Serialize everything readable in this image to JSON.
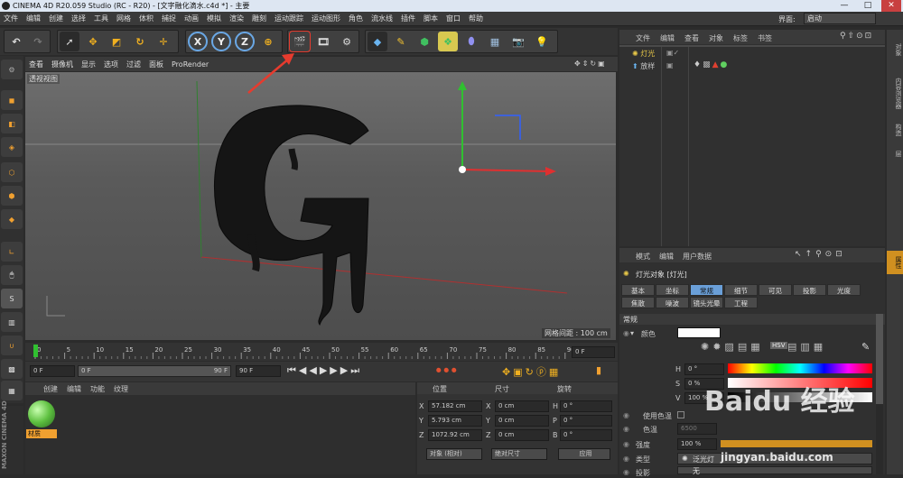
{
  "titlebar": {
    "title": "CINEMA 4D R20.059 Studio (RC - R20) - [文字融化滴水.c4d *] - 主要",
    "minimize": "—",
    "maximize": "□",
    "close": "✕"
  },
  "menubar": [
    "文件",
    "编辑",
    "创建",
    "选择",
    "工具",
    "网格",
    "体积",
    "捕捉",
    "动画",
    "模拟",
    "渲染",
    "雕刻",
    "运动跟踪",
    "运动图形",
    "角色",
    "流水线",
    "插件",
    "脚本",
    "窗口",
    "帮助"
  ],
  "layout": {
    "label": "界面:",
    "value": "启动"
  },
  "viewport": {
    "menu": [
      "查看",
      "摄像机",
      "显示",
      "选项",
      "过滤",
      "面板",
      "ProRender"
    ],
    "label": "透视视图",
    "grid_info": "网格间距 : 100 cm",
    "object_text": "G"
  },
  "timeline": {
    "ticks": [
      "0",
      "5",
      "10",
      "15",
      "20",
      "25",
      "30",
      "35",
      "40",
      "45",
      "50",
      "55",
      "60",
      "65",
      "70",
      "75",
      "80",
      "85",
      "90"
    ],
    "end_frame": "0 F"
  },
  "transport": {
    "start": "0 F",
    "current": "0 F",
    "range_end": "90 F",
    "end": "90 F"
  },
  "material_manager": {
    "menu": [
      "创建",
      "编辑",
      "功能",
      "纹理"
    ],
    "material_name": "材质"
  },
  "coordinates": {
    "headers": [
      "位置",
      "尺寸",
      "旋转"
    ],
    "rows": [
      {
        "axis": "X",
        "pos": "57.182 cm",
        "sizeaxis": "X",
        "size": "0 cm",
        "rotaxis": "H",
        "rot": "0 °"
      },
      {
        "axis": "Y",
        "pos": "5.793 cm",
        "sizeaxis": "Y",
        "size": "0 cm",
        "rotaxis": "P",
        "rot": "0 °"
      },
      {
        "axis": "Z",
        "pos": "1072.92 cm",
        "sizeaxis": "Z",
        "size": "0 cm",
        "rotaxis": "B",
        "rot": "0 °"
      }
    ],
    "mode": "对象 (相对)",
    "size_mode": "绝对尺寸",
    "apply": "应用"
  },
  "object_manager": {
    "menu": [
      "文件",
      "编辑",
      "查看",
      "对象",
      "标签",
      "书签"
    ],
    "objects": [
      {
        "name": "灯光",
        "color": "#e8c848"
      },
      {
        "name": "放样",
        "color": "#cfcfcf"
      }
    ]
  },
  "attribute_manager": {
    "menu": [
      "模式",
      "编辑",
      "用户数据"
    ],
    "title": "灯光对象 [灯光]",
    "tabs_row1": [
      "基本",
      "坐标",
      "常规",
      "细节",
      "可见",
      "投影",
      "光度"
    ],
    "tabs_row2": [
      "焦散",
      "噪波",
      "镜头光晕",
      "工程"
    ],
    "active_tab": "常规",
    "section": "常规",
    "color_label": "颜色",
    "h_label": "H",
    "h_value": "0 °",
    "s_label": "S",
    "s_value": "0 %",
    "v_label": "V",
    "v_value": "100 %",
    "use_temp": "使用色温",
    "temp_label": "色温",
    "temp_value": "6500",
    "intensity_label": "强度",
    "intensity_value": "100 %",
    "type_label": "类型",
    "type_value": "泛光灯",
    "shadow_label": "投影",
    "shadow_value": "无",
    "hsv_btn": "HSV"
  },
  "right_tabs": [
    "对象",
    "内容浏览器",
    "构造",
    "层"
  ],
  "attr_right_tab": "属性",
  "watermark": {
    "brand": "Baidu 经验",
    "url": "jingyan.baidu.com"
  },
  "colors": {
    "accent": "#4aa3df",
    "red_arrow": "#e63b2e",
    "axis_x": "#e03030",
    "axis_y": "#30c030",
    "axis_z": "#3060ff"
  }
}
